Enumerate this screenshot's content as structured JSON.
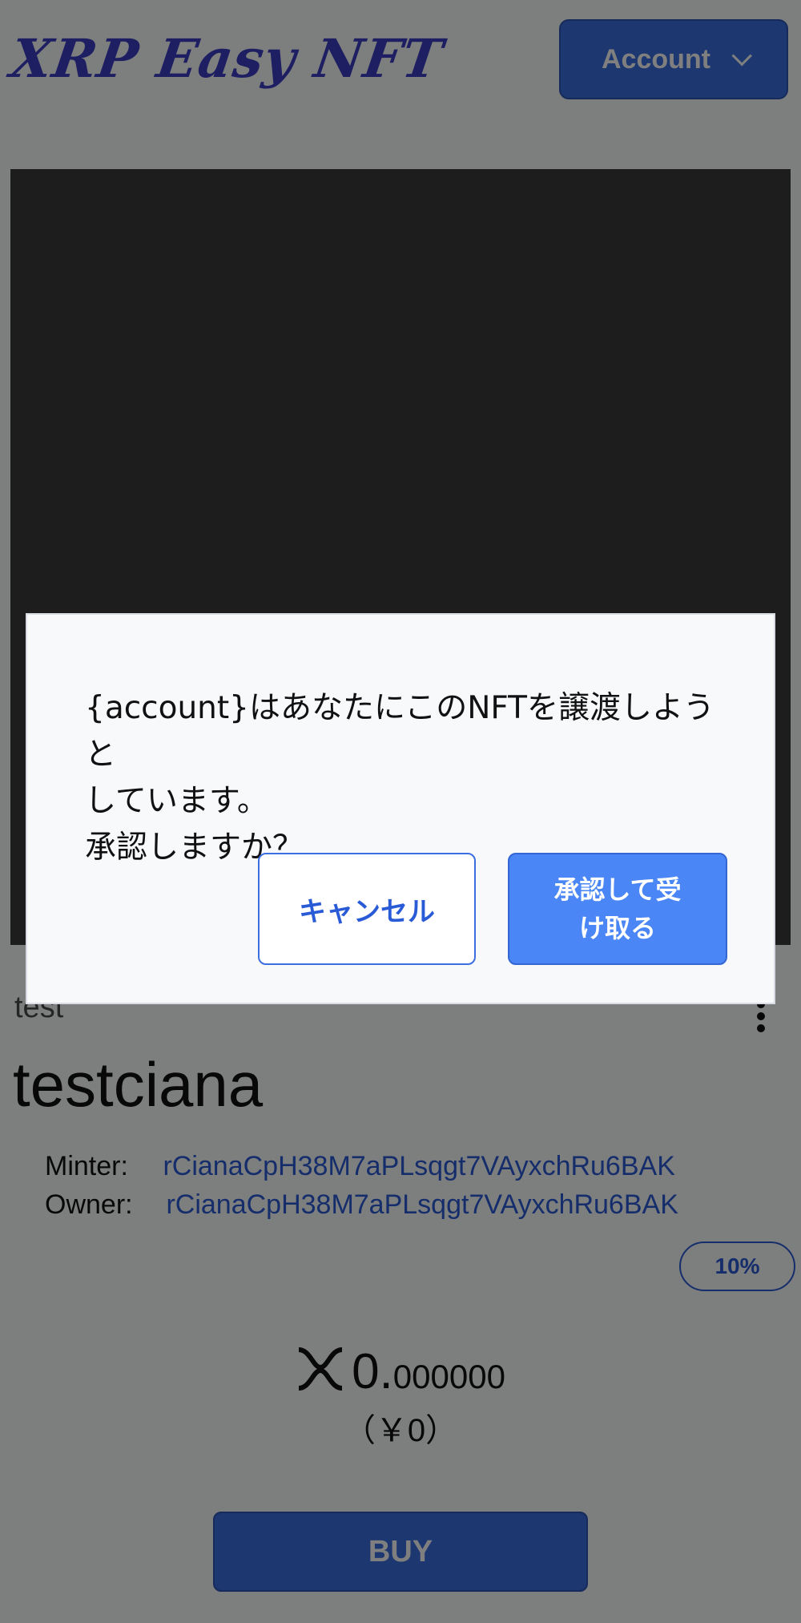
{
  "header": {
    "brand": "XRP Easy NFT",
    "account_label": "Account",
    "account_icon": "chevron-down-icon"
  },
  "nft": {
    "collection": "test",
    "name": "testciana",
    "minter_label": "Minter:",
    "minter": "rCianaCpH38M7aPLsqgt7VAyxchRu6BAK",
    "owner_label": "Owner:",
    "owner": "rCianaCpH38M7aPLsqgt7VAyxchRu6BAK",
    "royalty": "10%",
    "price_int": "0.",
    "price_dec": "000000",
    "fiat": "（￥0）",
    "buy_label": "BUY"
  },
  "dialog": {
    "line1": "{account}はあなたにこのNFTを譲渡しようと",
    "line2": "しています。",
    "line3": "承認しますか？",
    "cancel_label": "キャンセル",
    "accept_label": "承認して受け取る"
  },
  "colors": {
    "brand": "#3d3ec4",
    "primary": "#3b6fe0",
    "link": "#2a5bd7",
    "overlay": "rgba(0,0,0,0.5)"
  }
}
